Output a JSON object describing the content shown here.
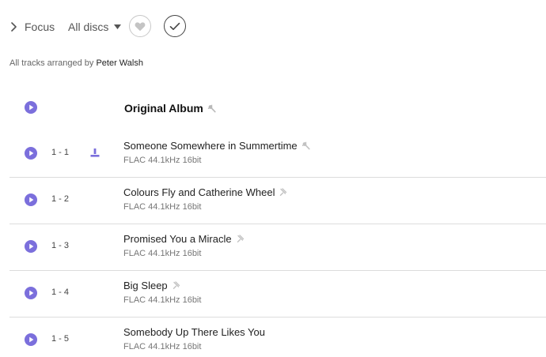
{
  "toolbar": {
    "focus_label": "Focus",
    "discs_label": "All discs",
    "favorite_icon": "heart-icon",
    "check_icon": "check-icon"
  },
  "credits": {
    "prefix": "All tracks arranged by",
    "arranger": "Peter Walsh"
  },
  "disc": {
    "title": "Original Album"
  },
  "tracks": [
    {
      "number": "1 - 1",
      "title": "Someone Somewhere in Summertime",
      "quality": "FLAC 44.1kHz 16bit",
      "downloaded": true
    },
    {
      "number": "1 - 2",
      "title": "Colours Fly and Catherine Wheel",
      "quality": "FLAC 44.1kHz 16bit",
      "downloaded": false
    },
    {
      "number": "1 - 3",
      "title": "Promised You a Miracle",
      "quality": "FLAC 44.1kHz 16bit",
      "downloaded": false
    },
    {
      "number": "1 - 4",
      "title": "Big Sleep",
      "quality": "FLAC 44.1kHz 16bit",
      "downloaded": false
    },
    {
      "number": "1 - 5",
      "title": "Somebody Up There Likes You",
      "quality": "FLAC 44.1kHz 16bit",
      "downloaded": false
    }
  ],
  "colors": {
    "accent": "#7b6fdc",
    "divider": "#dcdcdc"
  }
}
